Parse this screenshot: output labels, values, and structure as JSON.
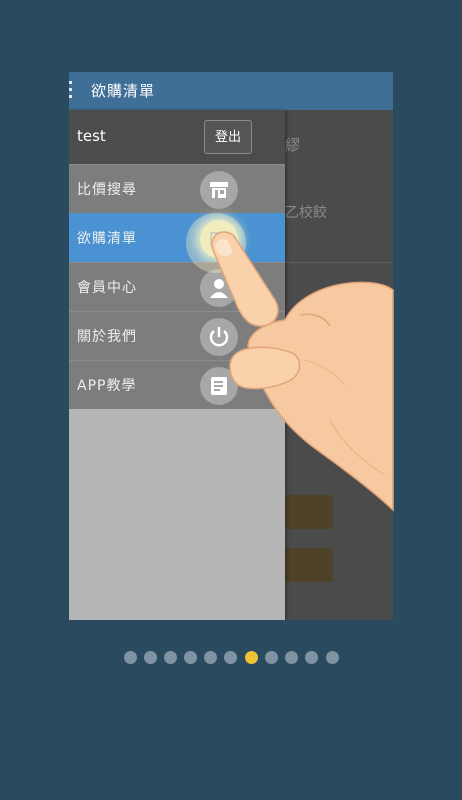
{
  "appbar": {
    "title": "欲購清單"
  },
  "main": {
    "text1": "繆",
    "text2": "乙校餃"
  },
  "drawer": {
    "user_name": "test",
    "logout_label": "登出",
    "items": [
      {
        "label": "比價搜尋",
        "icon": "store-icon",
        "active": false
      },
      {
        "label": "欲購清單",
        "icon": "cart-icon",
        "active": true
      },
      {
        "label": "會員中心",
        "icon": "member-icon",
        "active": false
      },
      {
        "label": "關於我們",
        "icon": "power-icon",
        "active": false
      },
      {
        "label": "APP教學",
        "icon": "tutorial-icon",
        "active": false
      }
    ]
  },
  "pager": {
    "total": 11,
    "current": 6
  },
  "colors": {
    "background": "#2a4a60",
    "appbar": "#3f6e96",
    "active_item": "#4b92d2",
    "active_dot": "#f0c335",
    "inactive_dot": "#7f93a3"
  }
}
